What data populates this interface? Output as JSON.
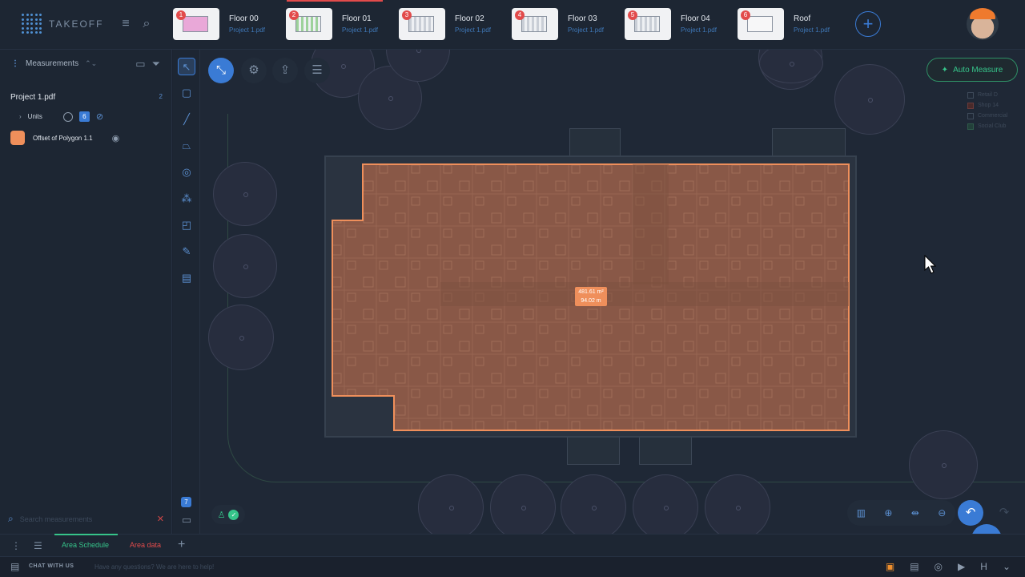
{
  "app": {
    "logo_text": "TAKEOFF"
  },
  "tabs": [
    {
      "num": "1",
      "name": "Floor 00",
      "file": "Project 1.pdf"
    },
    {
      "num": "2",
      "name": "Floor 01",
      "file": "Project 1.pdf"
    },
    {
      "num": "3",
      "name": "Floor 02",
      "file": "Project 1.pdf"
    },
    {
      "num": "4",
      "name": "Floor 03",
      "file": "Project 1.pdf"
    },
    {
      "num": "5",
      "name": "Floor 04",
      "file": "Project 1.pdf"
    },
    {
      "num": "6",
      "name": "Roof",
      "file": "Project 1.pdf"
    }
  ],
  "left_panel": {
    "title": "Measurements",
    "project_name": "Project 1.pdf",
    "project_count": "2",
    "units_label": "Units",
    "units_count": "6",
    "polygon_label": "Offset of Polygon 1.1",
    "search_placeholder": "Search measurements"
  },
  "rail": {
    "badge_count": "7"
  },
  "canvas": {
    "auto_measure_label": "Auto Measure",
    "measure_area": "481.61 m²",
    "measure_perimeter": "94.02 m",
    "legend": [
      "Retail D",
      "Shop 14",
      "Commercial",
      "Social Club"
    ]
  },
  "bottom_tabs": {
    "tab1": "Area Schedule",
    "tab2": "Area data"
  },
  "footer": {
    "chat_label": "CHAT WITH US",
    "chat_hint": "Have any questions? We are here to help!"
  },
  "colors": {
    "accent": "#3a7bd5",
    "polygon": "#ef8f5b",
    "success": "#36c48a",
    "danger": "#e24b4b"
  }
}
